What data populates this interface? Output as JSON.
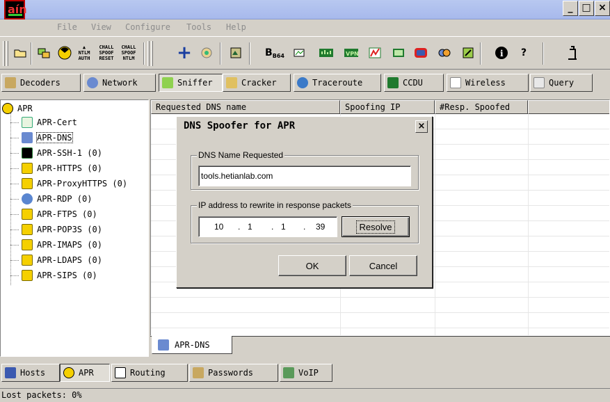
{
  "window": {
    "minimize": "_",
    "restore": "□",
    "close": "×"
  },
  "app_logo": "aín",
  "menu": [
    "File",
    "View",
    "Configure",
    "Tools",
    "Help"
  ],
  "toolbar": {
    "ntlm_auth": [
      "NTLM",
      "AUTH"
    ],
    "chall_reset": [
      "CHALL",
      "SPOOF",
      "RESET"
    ],
    "chall_ntlm": [
      "CHALL",
      "SPOOF",
      "NTLM"
    ],
    "b64": "B64"
  },
  "tabs": [
    {
      "label": "Decoders",
      "icon": "decoders-icon"
    },
    {
      "label": "Network",
      "icon": "network-icon"
    },
    {
      "label": "Sniffer",
      "icon": "sniffer-icon"
    },
    {
      "label": "Cracker",
      "icon": "cracker-icon"
    },
    {
      "label": "Traceroute",
      "icon": "traceroute-icon"
    },
    {
      "label": "CCDU",
      "icon": "ccdu-icon"
    },
    {
      "label": "Wireless",
      "icon": "wireless-icon"
    },
    {
      "label": "Query",
      "icon": "query-icon"
    }
  ],
  "tree": {
    "root": "APR",
    "items": [
      "APR-Cert",
      "APR-DNS",
      "APR-SSH-1  (0)",
      "APR-HTTPS  (0)",
      "APR-ProxyHTTPS  (0)",
      "APR-RDP  (0)",
      "APR-FTPS  (0)",
      "APR-POP3S  (0)",
      "APR-IMAPS  (0)",
      "APR-LDAPS  (0)",
      "APR-SIPS  (0)"
    ]
  },
  "list": {
    "columns": [
      "Requested DNS name",
      "Spoofing IP",
      "#Resp. Spoofed",
      ""
    ]
  },
  "inner_tab": "APR-DNS",
  "bottom_tabs": [
    "Hosts",
    "APR",
    "Routing",
    "Passwords",
    "VoIP"
  ],
  "status": "Lost packets:   0%",
  "dialog": {
    "title": "DNS Spoofer for APR",
    "close": "×",
    "group1_title": "DNS Name Requested",
    "dns_name": "tools.hetianlab.com",
    "group2_title": "IP address to rewrite in response packets",
    "ip": [
      "10",
      "1",
      "1",
      "39"
    ],
    "resolve": "Resolve",
    "ok": "OK",
    "cancel": "Cancel"
  },
  "colors": {
    "face": "#d4d0c8",
    "title_bar": "#a7b9ec",
    "disabled_text": "#8c8c8c"
  }
}
